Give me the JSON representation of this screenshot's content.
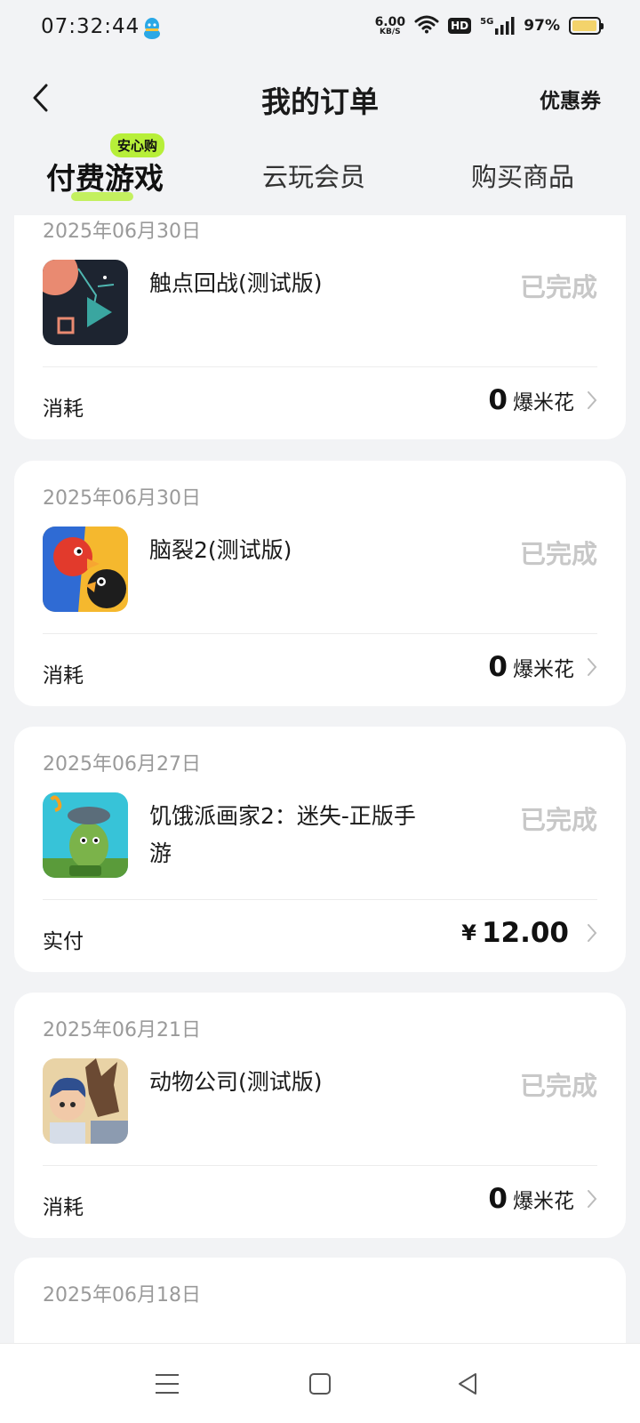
{
  "status_bar": {
    "time": "07:32:44",
    "net_speed_value": "6.00",
    "net_speed_unit": "KB/S",
    "hd_label": "HD",
    "signal_label": "5G",
    "battery_percent": "97%",
    "battery_level": 0.97,
    "icons": [
      "qq-icon",
      "wifi-icon",
      "hd-icon",
      "signal-icon",
      "battery-icon"
    ]
  },
  "header": {
    "title": "我的订单",
    "right_link": "优惠券",
    "back_icon": "back-arrow-icon"
  },
  "tabs": {
    "items": [
      {
        "label": "付费游戏",
        "active": true
      },
      {
        "label": "云玩会员",
        "active": false
      },
      {
        "label": "购买商品",
        "active": false
      }
    ],
    "badge": "安心购",
    "accent_color": "#b7ef39"
  },
  "orders": [
    {
      "date": "2025年06月30日",
      "name": "触点回战(测试版)",
      "status": "已完成",
      "row_label": "消耗",
      "currency": "",
      "amount": "0",
      "unit": "爆米花"
    },
    {
      "date": "2025年06月30日",
      "name": "脑裂2(测试版)",
      "status": "已完成",
      "row_label": "消耗",
      "currency": "",
      "amount": "0",
      "unit": "爆米花"
    },
    {
      "date": "2025年06月27日",
      "name": "饥饿派画家2：迷失-正版手游",
      "status": "已完成",
      "row_label": "实付",
      "currency": "¥",
      "amount": "12.00",
      "unit": ""
    },
    {
      "date": "2025年06月21日",
      "name": "动物公司(测试版)",
      "status": "已完成",
      "row_label": "消耗",
      "currency": "",
      "amount": "0",
      "unit": "爆米花"
    },
    {
      "date": "2025年06月18日"
    }
  ],
  "nav_bar": {
    "icons": [
      "menu-icon",
      "home-square-icon",
      "back-triangle-icon"
    ]
  }
}
